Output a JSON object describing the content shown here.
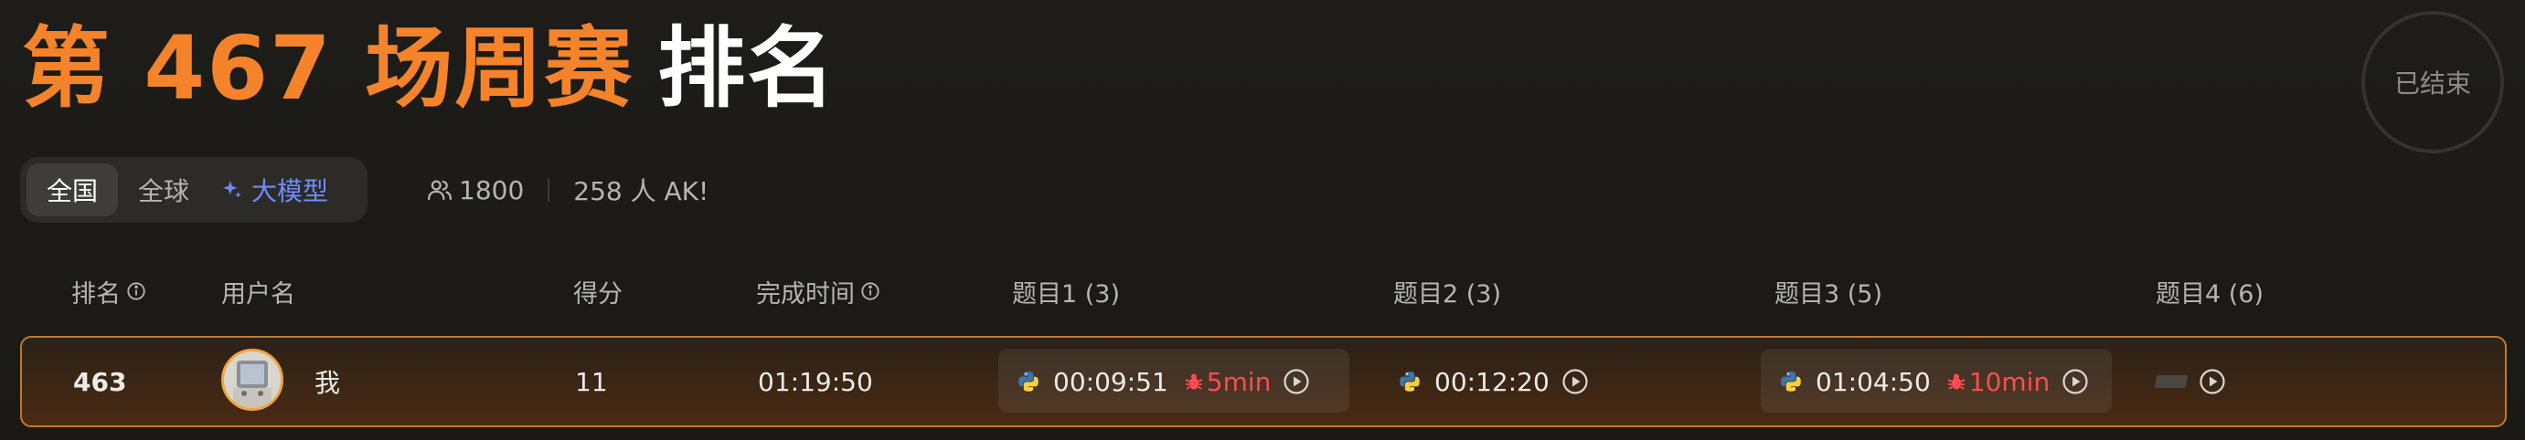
{
  "header": {
    "title_prefix": "第 467 场周赛",
    "title_suffix": "排名",
    "status": "已结束"
  },
  "scope_tabs": [
    {
      "label": "全国",
      "active": true
    },
    {
      "label": "全球",
      "active": false
    },
    {
      "label": "大模型",
      "active": false,
      "icon": "sparkle-icon"
    }
  ],
  "stats": {
    "participants": "1800",
    "ak_text": "258 人 AK!"
  },
  "columns": {
    "rank": "排名",
    "username": "用户名",
    "score": "得分",
    "finish_time": "完成时间",
    "q1": "题目1 (3)",
    "q2": "题目2 (3)",
    "q3": "题目3 (5)",
    "q4": "题目4 (6)"
  },
  "my_row": {
    "rank": "463",
    "username": "我",
    "score": "11",
    "finish_time": "01:19:50",
    "q1": {
      "time": "00:09:51",
      "penalty": "5min",
      "language": "python-icon"
    },
    "q2": {
      "time": "00:12:20",
      "language": "python-icon"
    },
    "q3": {
      "time": "01:04:50",
      "penalty": "10min",
      "language": "python-icon"
    },
    "q4": {
      "solved": false
    }
  },
  "colors": {
    "accent_orange": "#f5832a",
    "penalty_red": "#ff4d4f",
    "llm_blue": "#6f8bff",
    "row_border": "#c07a2a"
  }
}
